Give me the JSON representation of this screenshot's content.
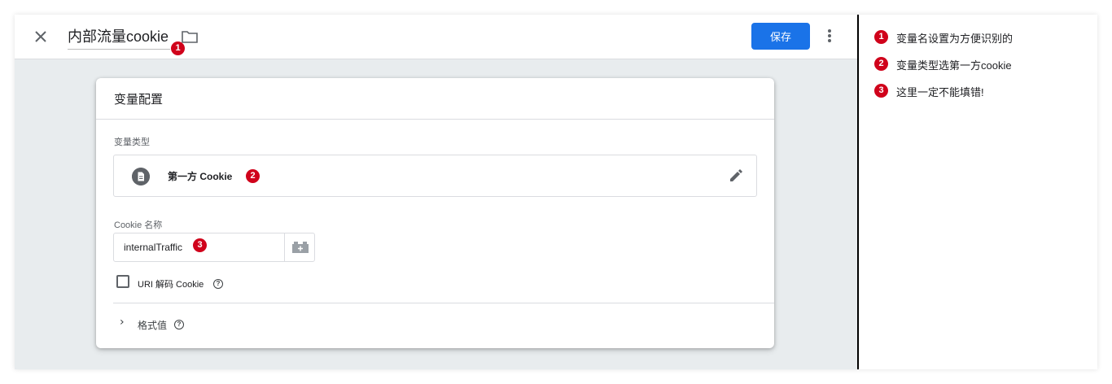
{
  "header": {
    "title": "内部流量cookie",
    "save_label": "保存",
    "annotation_marker": "1"
  },
  "card": {
    "title": "变量配置",
    "type_label": "变量类型",
    "type_value": "第一方 Cookie",
    "type_marker": "2",
    "cookie_name_label": "Cookie 名称",
    "cookie_name_value": "internalTraffic",
    "cookie_name_marker": "3",
    "uri_decode_label": "URI 解码 Cookie",
    "uri_decode_checked": false,
    "format_value_label": "格式值"
  },
  "notes": [
    {
      "marker": "1",
      "text": "变量名设置为方便识别的"
    },
    {
      "marker": "2",
      "text": "变量类型选第一方cookie"
    },
    {
      "marker": "3",
      "text": "这里一定不能填错!"
    }
  ],
  "colors": {
    "accent": "#1a73e8",
    "marker": "#d0021b",
    "background": "#e8ecee"
  },
  "icons": [
    "close-icon",
    "folder-icon",
    "more-vert-icon",
    "document-icon",
    "edit-icon",
    "variable-picker-icon",
    "help-icon",
    "chevron-right-icon"
  ]
}
